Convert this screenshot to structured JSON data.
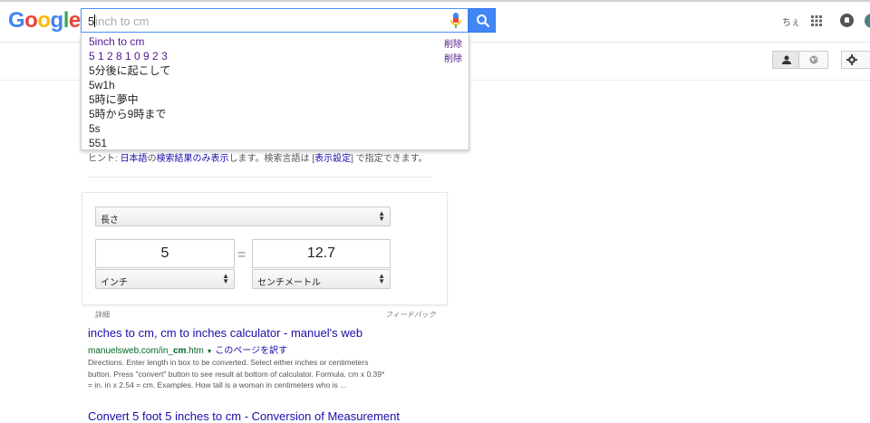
{
  "logo": {
    "g1": "G",
    "o1": "o",
    "o2": "o",
    "g2": "g",
    "l": "l",
    "e": "e"
  },
  "search": {
    "typed": "5",
    "hint": "inch to cm"
  },
  "header": {
    "right_text": "ちぇ"
  },
  "suggestions": [
    {
      "text": "5inch to cm",
      "history": true
    },
    {
      "text": "5 1 2 8 1 0 9 2 3",
      "history": true
    },
    {
      "text": "5分後に起こして",
      "history": false
    },
    {
      "text": "5w1h",
      "history": false
    },
    {
      "text": "5時に夢中",
      "history": false
    },
    {
      "text": "5時から9時まで",
      "history": false
    },
    {
      "text": "5s",
      "history": false
    },
    {
      "text": "551",
      "history": false
    }
  ],
  "delete_label": "削除",
  "hint": {
    "prefix": "ヒント: ",
    "link1": "日本語",
    "mid1": "の",
    "link2": "検索結果のみ表示",
    "mid2": "します。検索言語は [",
    "link3": "表示設定",
    "suffix": "] で指定できます。"
  },
  "converter": {
    "category": "長さ",
    "from_value": "5",
    "to_value": "12.7",
    "equals": "=",
    "from_unit": "インチ",
    "to_unit": "センチメートル",
    "details": "詳細",
    "feedback": "フィードバック"
  },
  "result1": {
    "title": "inches to cm, cm to inches calculator - manuel's web",
    "url_prefix": "manuelsweb.com/in_",
    "url_bold": "cm",
    "url_suffix": ".htm",
    "translate": "このページを訳す",
    "snippet_lines": [
      "Directions. Enter length in box to be converted. Select either inches or centimeters",
      "button. Press \"convert\" button to see result at bottom of calculator. Formula. cm x 0.39*",
      "= in. in x 2.54 = cm. Examples. How tall is a woman in centimeters who is ..."
    ]
  },
  "result2": {
    "title": "Convert 5 foot 5 inches to cm - Conversion of Measurement"
  }
}
